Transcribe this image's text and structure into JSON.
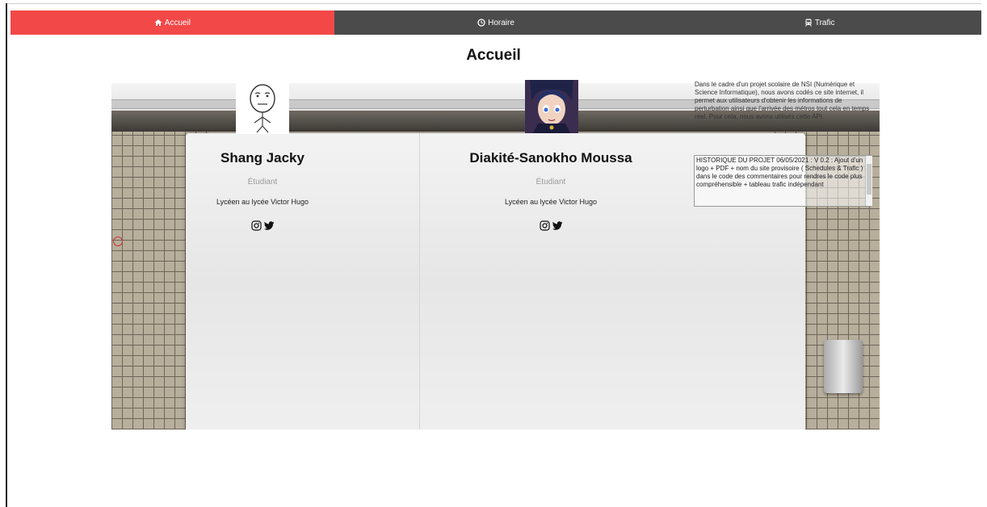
{
  "nav": {
    "items": [
      {
        "label": "Accueil",
        "icon": "home-icon",
        "active": true
      },
      {
        "label": "Horaire",
        "icon": "clock-icon",
        "active": false
      },
      {
        "label": "Trafic",
        "icon": "train-icon",
        "active": false
      }
    ]
  },
  "page": {
    "title": "Accueil"
  },
  "profiles": [
    {
      "name": "Shang Jacky",
      "role": "Étudiant",
      "desc": "Lycéen au lycée Victor Hugo",
      "avatar": "troll-face-avatar"
    },
    {
      "name": "Diakité-Sanokho Moussa",
      "role": "Étudiant",
      "desc": "Lycéen au lycée Victor Hugo",
      "avatar": "anime-avatar"
    }
  ],
  "about": {
    "text": "Dans le cadre d'un projet scolaire de NSI (Numérique et Science Informatique), nous avons codés ce site internet, il permet aux utilisateurs d'obtenir les informations de perturbation ainsi que l'arrivée des métros tout cela en temps réel. Pour cela, nous avons utilisés cette API."
  },
  "history": {
    "text": "HISTORIQUE DU PROJET 06/05/2021 : V 0.2 : Ajout d'un logo + PDF + nom du site provisoire ( Schedules & Trafic ) + dans le code des commentaires pour rendres le code plus compréhensible + tableau trafic indépendant"
  },
  "colors": {
    "nav_active": "#f24848",
    "nav_bg": "#4b4b4b"
  }
}
